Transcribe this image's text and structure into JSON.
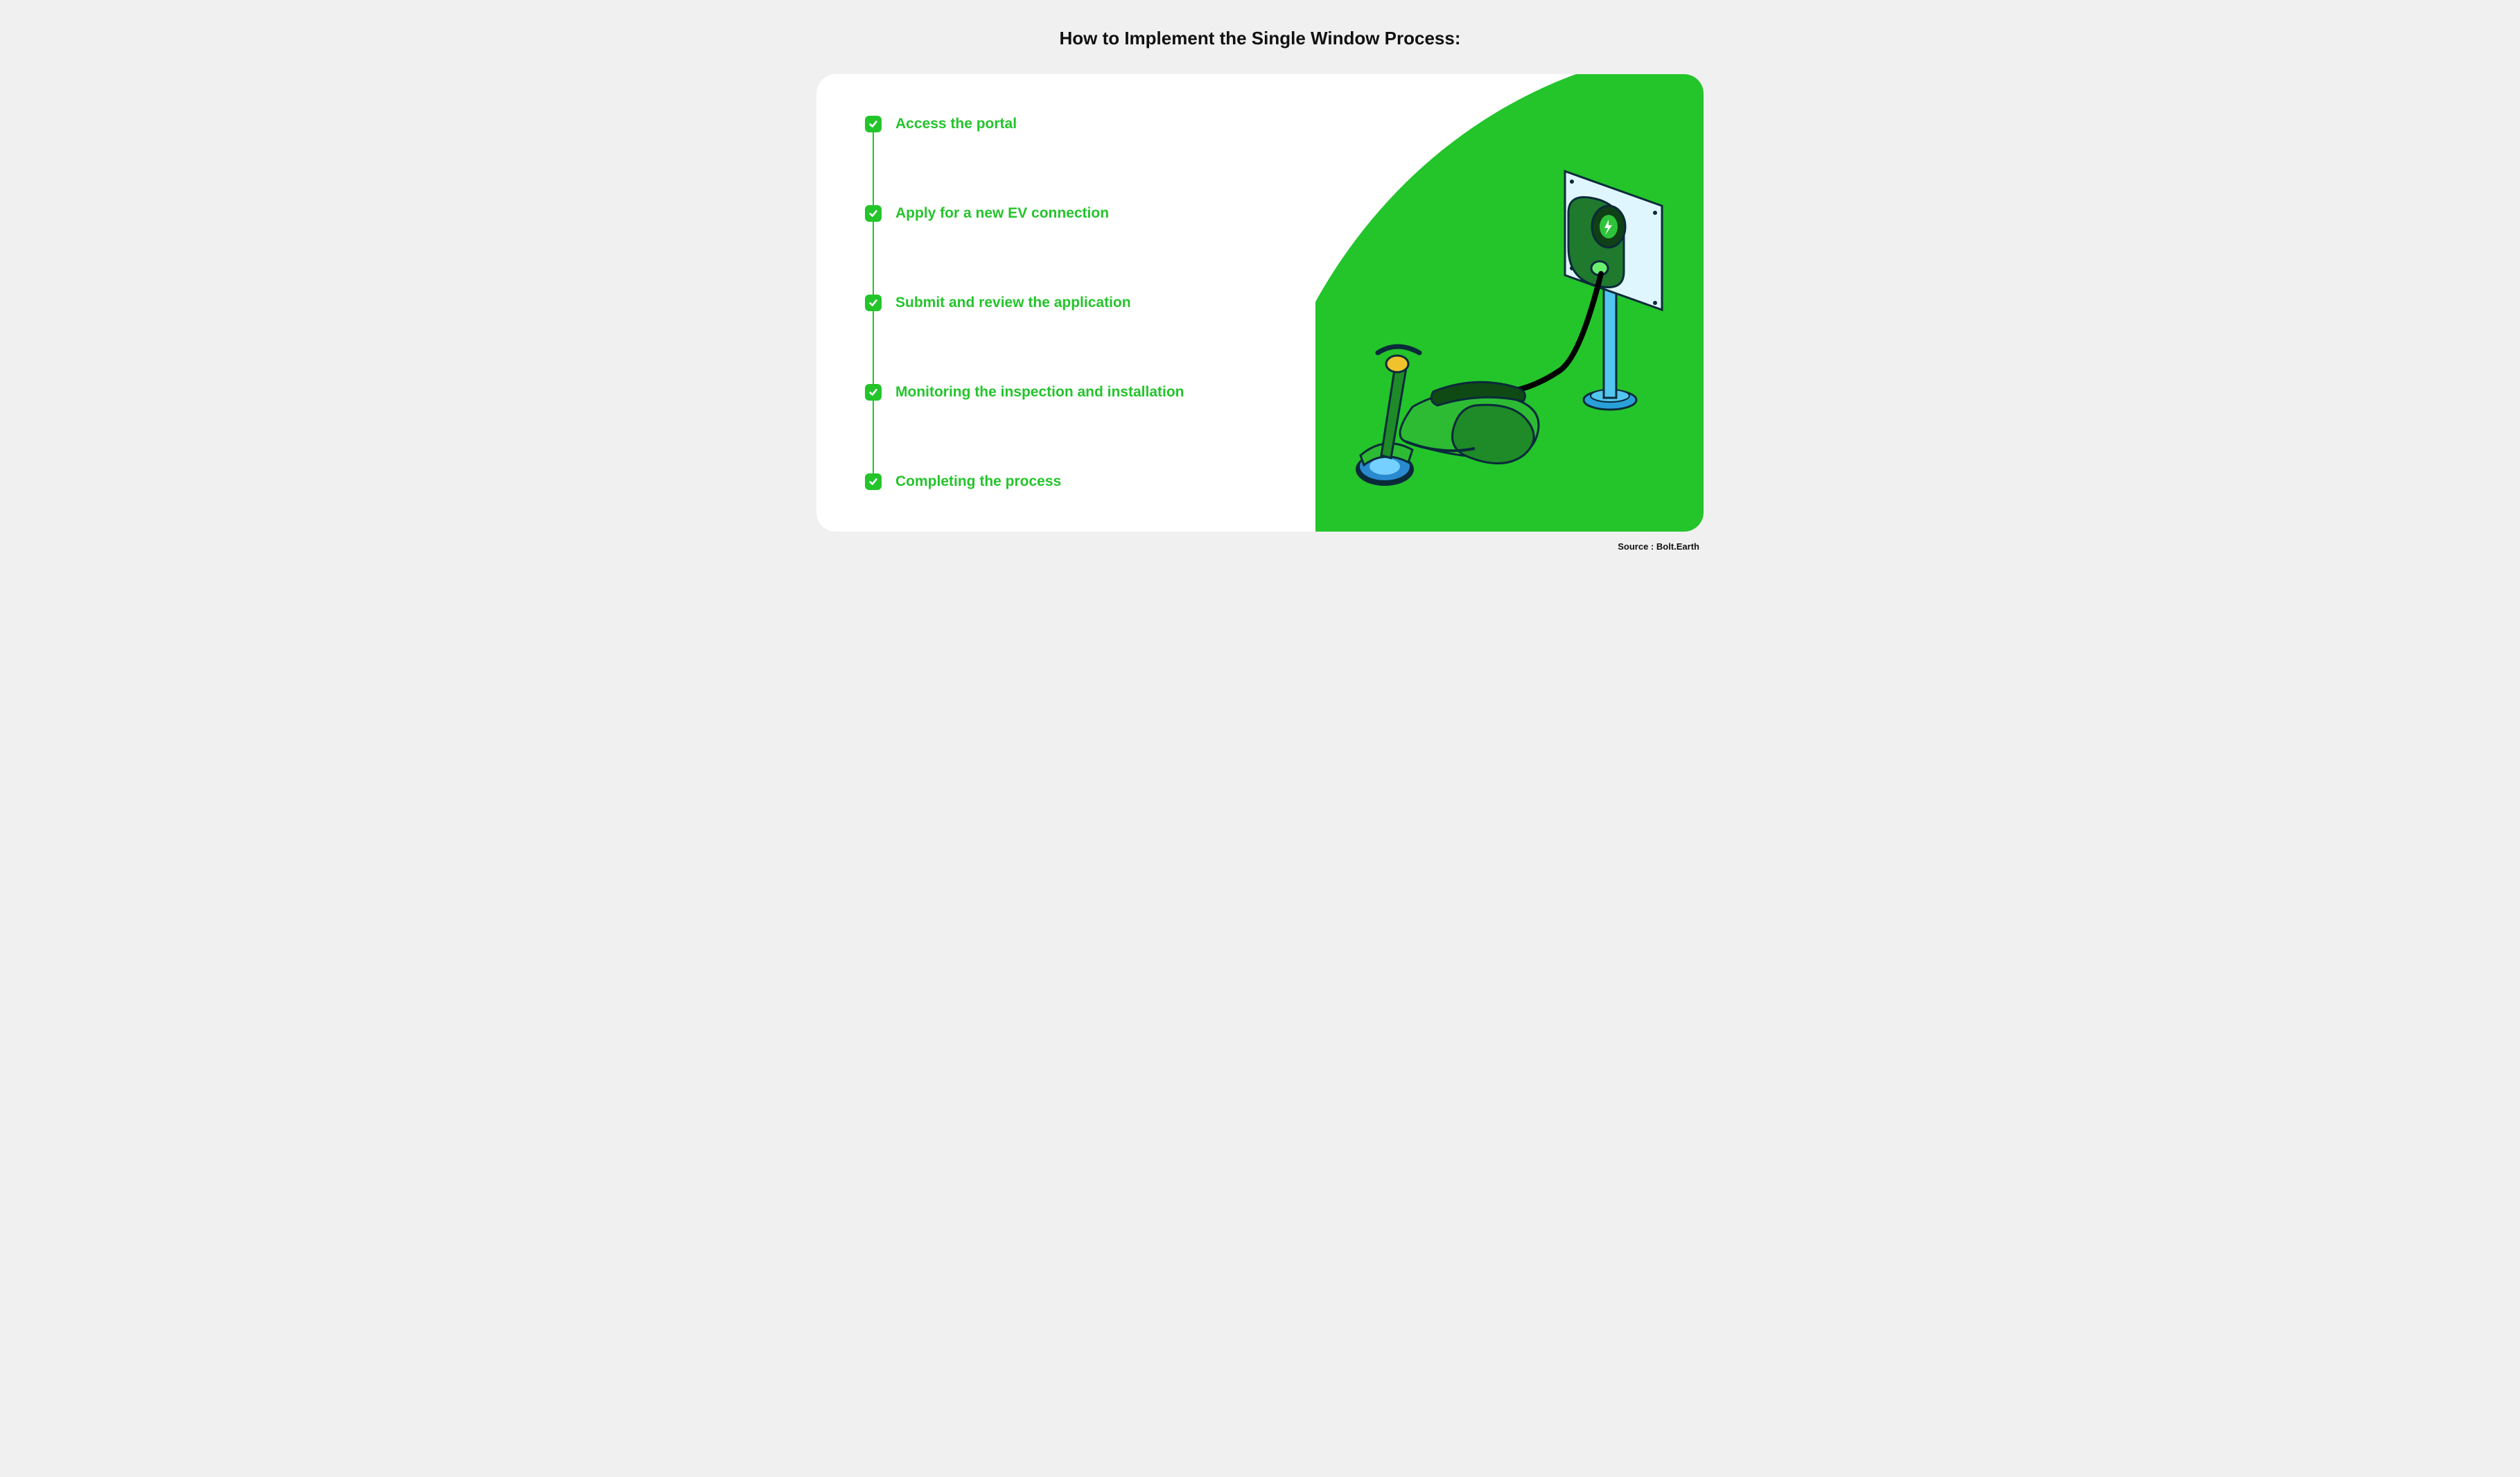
{
  "title": "How to Implement the Single Window Process:",
  "steps": [
    {
      "label": "Access the portal"
    },
    {
      "label": "Apply for a new EV connection"
    },
    {
      "label": "Submit and review the application"
    },
    {
      "label": "Monitoring the inspection and installation"
    },
    {
      "label": "Completing the process"
    }
  ],
  "source": "Source : Bolt.Earth",
  "colors": {
    "accent": "#24c42b",
    "background": "#f0f0f0",
    "card": "#ffffff",
    "text_title": "#111111"
  },
  "illustration": {
    "description": "Isometric green electric scooter plugged via black cable into a wall-mounted EV charger on a stand"
  }
}
